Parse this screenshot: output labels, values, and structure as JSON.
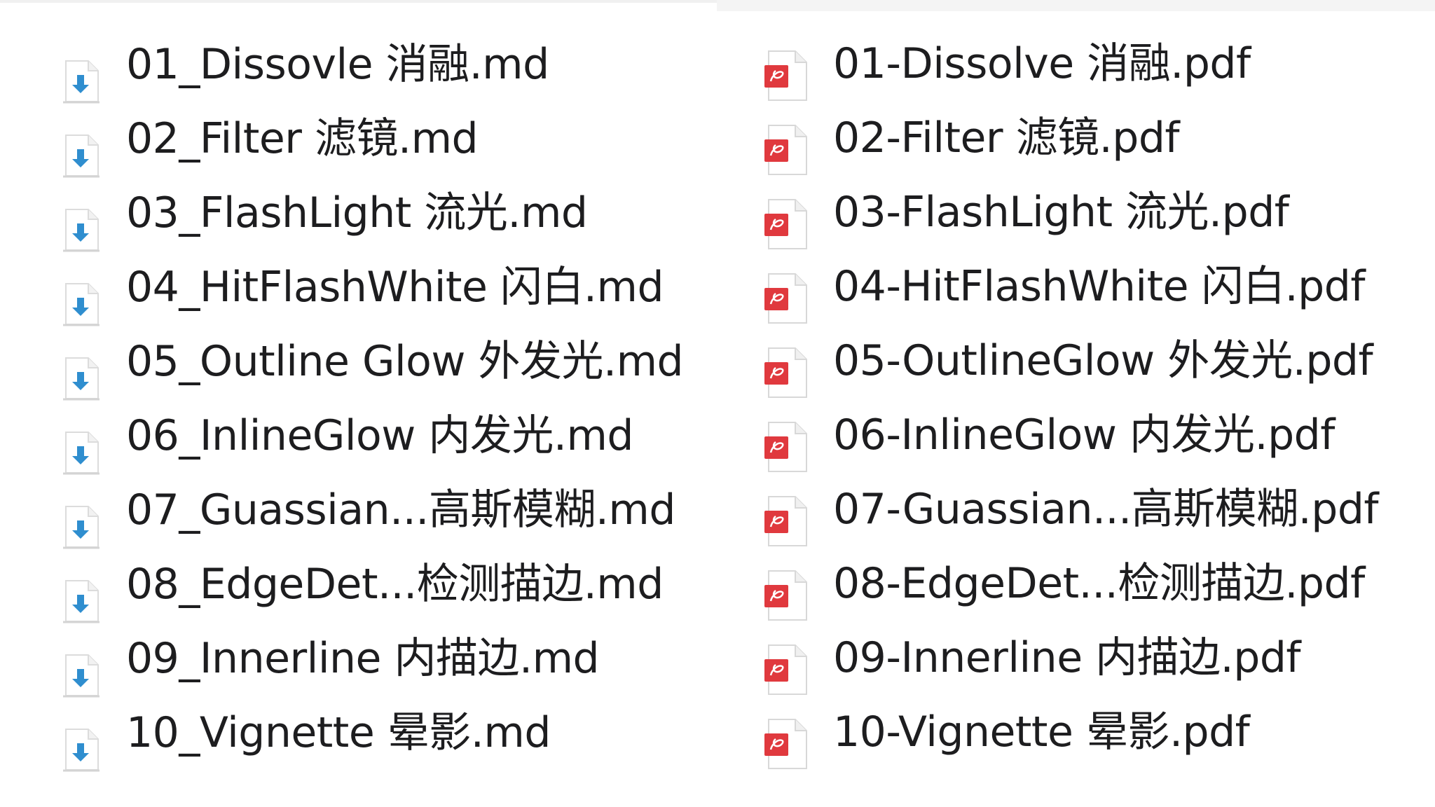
{
  "left_pane": {
    "files": [
      {
        "name": "01_Dissovle 消融.md",
        "icon": "markdown-download-icon"
      },
      {
        "name": "02_Filter 滤镜.md",
        "icon": "markdown-download-icon"
      },
      {
        "name": "03_FlashLight 流光.md",
        "icon": "markdown-download-icon"
      },
      {
        "name": "04_HitFlashWhite 闪白.md",
        "icon": "markdown-download-icon"
      },
      {
        "name": "05_Outline Glow 外发光.md",
        "icon": "markdown-download-icon"
      },
      {
        "name": "06_InlineGlow 内发光.md",
        "icon": "markdown-download-icon"
      },
      {
        "name": "07_Guassian...高斯模糊.md",
        "icon": "markdown-download-icon"
      },
      {
        "name": "08_EdgeDet...检测描边.md",
        "icon": "markdown-download-icon"
      },
      {
        "name": "09_Innerline 内描边.md",
        "icon": "markdown-download-icon"
      },
      {
        "name": "10_Vignette 晕影.md",
        "icon": "markdown-download-icon"
      }
    ]
  },
  "right_pane": {
    "files": [
      {
        "name": "01-Dissolve 消融.pdf",
        "icon": "pdf-icon"
      },
      {
        "name": "02-Filter 滤镜.pdf",
        "icon": "pdf-icon"
      },
      {
        "name": "03-FlashLight 流光.pdf",
        "icon": "pdf-icon"
      },
      {
        "name": "04-HitFlashWhite 闪白.pdf",
        "icon": "pdf-icon"
      },
      {
        "name": "05-OutlineGlow 外发光.pdf",
        "icon": "pdf-icon"
      },
      {
        "name": "06-InlineGlow 内发光.pdf",
        "icon": "pdf-icon"
      },
      {
        "name": "07-Guassian...高斯模糊.pdf",
        "icon": "pdf-icon"
      },
      {
        "name": "08-EdgeDet...检测描边.pdf",
        "icon": "pdf-icon"
      },
      {
        "name": "09-Innerline 内描边.pdf",
        "icon": "pdf-icon"
      },
      {
        "name": "10-Vignette 晕影.pdf",
        "icon": "pdf-icon"
      }
    ]
  },
  "colors": {
    "pdf_badge": "#e0393e",
    "download_arrow": "#2f8ecf",
    "text": "#1d1d1f"
  }
}
